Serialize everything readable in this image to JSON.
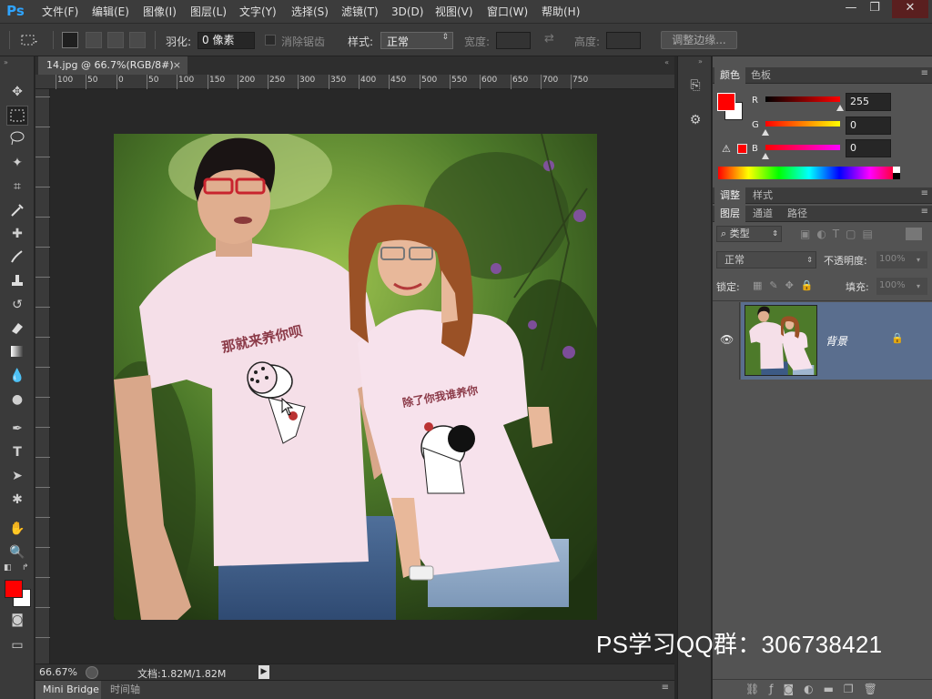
{
  "app": {
    "logo": "Ps"
  },
  "menu": [
    "文件(F)",
    "编辑(E)",
    "图像(I)",
    "图层(L)",
    "文字(Y)",
    "选择(S)",
    "滤镜(T)",
    "3D(D)",
    "视图(V)",
    "窗口(W)",
    "帮助(H)"
  ],
  "window_controls": {
    "minimize": "—",
    "restore": "❐",
    "close": "✕"
  },
  "options": {
    "feather_label": "羽化:",
    "feather_value": "0 像素",
    "antialias_label": "消除锯齿",
    "style_label": "样式:",
    "style_value": "正常",
    "width_label": "宽度:",
    "height_label": "高度:",
    "refine_button": "调整边缘..."
  },
  "document": {
    "tab_title": "14.jpg @ 66.7%(RGB/8#)",
    "tab_close": "×",
    "ruler_labels": [
      "100",
      "50",
      "0",
      "50",
      "100",
      "150",
      "200",
      "250",
      "300",
      "350",
      "400",
      "450",
      "500",
      "550",
      "600",
      "650",
      "700",
      "750"
    ],
    "zoom": "66.67%",
    "doc_info": "文档:1.82M/1.82M",
    "shirt_text_man": "那就来养你呗",
    "shirt_text_woman": "除了你我谁养你"
  },
  "bottom_tabs": [
    "Mini Bridge",
    "时间轴"
  ],
  "color_panel": {
    "tabs": [
      "颜色",
      "色板"
    ],
    "channels": [
      {
        "label": "R",
        "value": "255",
        "fraction": 1.0
      },
      {
        "label": "G",
        "value": "0",
        "fraction": 0.0
      },
      {
        "label": "B",
        "value": "0",
        "fraction": 0.0
      }
    ],
    "foreground": "#ff0000",
    "background": "#ffffff"
  },
  "adjust_panel": {
    "tabs": [
      "调整",
      "样式"
    ]
  },
  "layers_panel": {
    "tabs": [
      "图层",
      "通道",
      "路径"
    ],
    "filter_label": "类型",
    "blend_mode": "正常",
    "opacity_label": "不透明度:",
    "opacity_value": "100%",
    "lock_label": "锁定:",
    "fill_label": "填充:",
    "fill_value": "100%",
    "layers": [
      {
        "name": "背景",
        "visible": true,
        "locked": true
      }
    ]
  },
  "watermark": "PS学习QQ群：306738421",
  "colors": {
    "accent": "#2fa4ff",
    "layer_selected": "#5a6e8e",
    "foreground": "#ff0000"
  }
}
